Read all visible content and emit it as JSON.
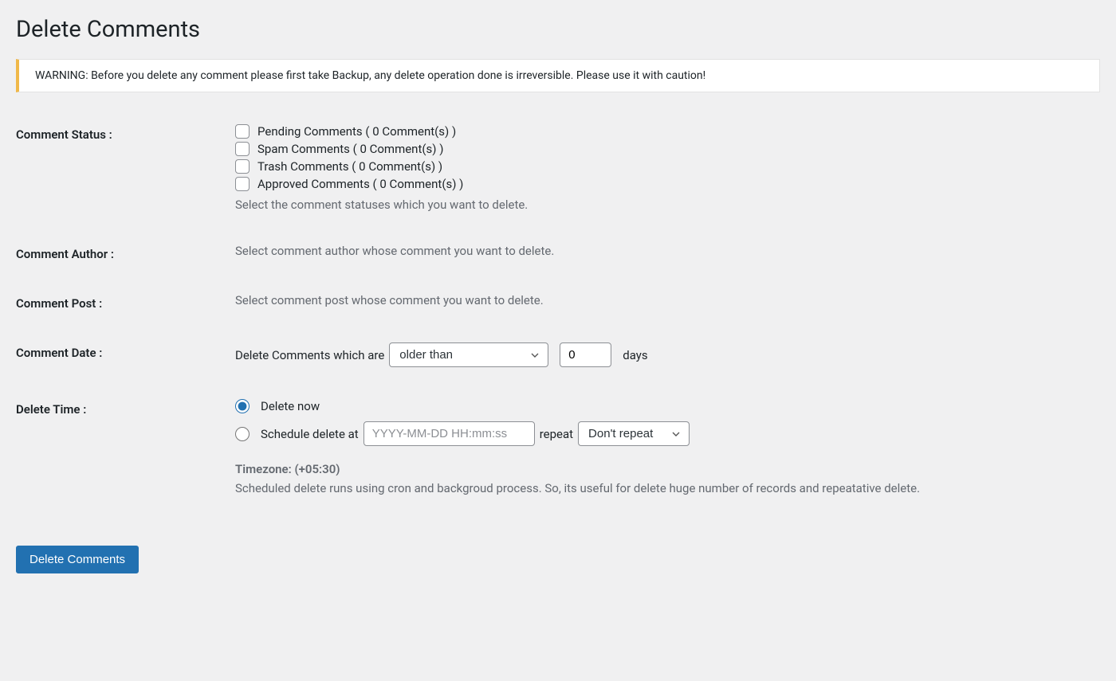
{
  "page_title": "Delete Comments",
  "warning": "WARNING: Before you delete any comment please first take Backup, any delete operation done is irreversible. Please use it with caution!",
  "comment_status": {
    "label": "Comment Status :",
    "options": [
      {
        "label": "Pending Comments ( 0 Comment(s) )"
      },
      {
        "label": "Spam Comments ( 0 Comment(s) )"
      },
      {
        "label": "Trash Comments ( 0 Comment(s) )"
      },
      {
        "label": "Approved Comments ( 0 Comment(s) )"
      }
    ],
    "helper": "Select the comment statuses which you want to delete."
  },
  "comment_author": {
    "label": "Comment Author :",
    "helper": "Select comment author whose comment you want to delete."
  },
  "comment_post": {
    "label": "Comment Post :",
    "helper": "Select comment post whose comment you want to delete."
  },
  "comment_date": {
    "label": "Comment Date :",
    "prefix": "Delete Comments which are",
    "select_value": "older than",
    "number_value": "0",
    "suffix": "days"
  },
  "delete_time": {
    "label": "Delete Time :",
    "now_label": "Delete now",
    "schedule_label": "Schedule delete at",
    "datetime_placeholder": "YYYY-MM-DD HH:mm:ss",
    "repeat_label": "repeat",
    "repeat_value": "Don't repeat",
    "timezone": "Timezone: (+05:30)",
    "helper": "Scheduled delete runs using cron and backgroud process. So, its useful for delete huge number of records and repeatative delete."
  },
  "submit_button": "Delete Comments"
}
